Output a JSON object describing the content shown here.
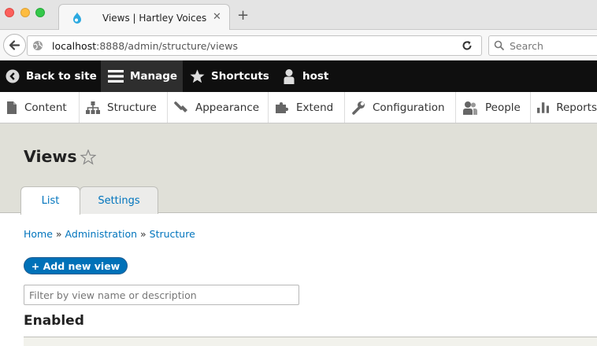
{
  "browser": {
    "tab_title": "Views | Hartley Voices",
    "tab_close": "✕",
    "new_tab": "+",
    "url_host": "localhost",
    "url_rest": ":8888/admin/structure/views",
    "search_placeholder": "Search"
  },
  "toolbar": {
    "back_to_site": "Back to site",
    "manage": "Manage",
    "shortcuts": "Shortcuts",
    "user": "host"
  },
  "tray": {
    "items": [
      {
        "label": "Content",
        "icon": "file-icon"
      },
      {
        "label": "Structure",
        "icon": "sitemap-icon"
      },
      {
        "label": "Appearance",
        "icon": "brush-icon"
      },
      {
        "label": "Extend",
        "icon": "puzzle-icon"
      },
      {
        "label": "Configuration",
        "icon": "wrench-icon"
      },
      {
        "label": "People",
        "icon": "people-icon"
      },
      {
        "label": "Reports",
        "icon": "bar-chart-icon"
      }
    ]
  },
  "page": {
    "title": "Views",
    "tabs": [
      {
        "label": "List",
        "active": true
      },
      {
        "label": "Settings",
        "active": false
      }
    ]
  },
  "breadcrumb": {
    "home": "Home",
    "administration": "Administration",
    "structure": "Structure",
    "separator": "»"
  },
  "content": {
    "add_button": "+ Add new view",
    "filter_placeholder": "Filter by view name or description",
    "section_enabled": "Enabled"
  },
  "colors": {
    "toolbar_bg": "#0f0f0f",
    "link": "#0074bd",
    "button_bg": "#0071b8",
    "header_bg": "#e0e0d8"
  }
}
